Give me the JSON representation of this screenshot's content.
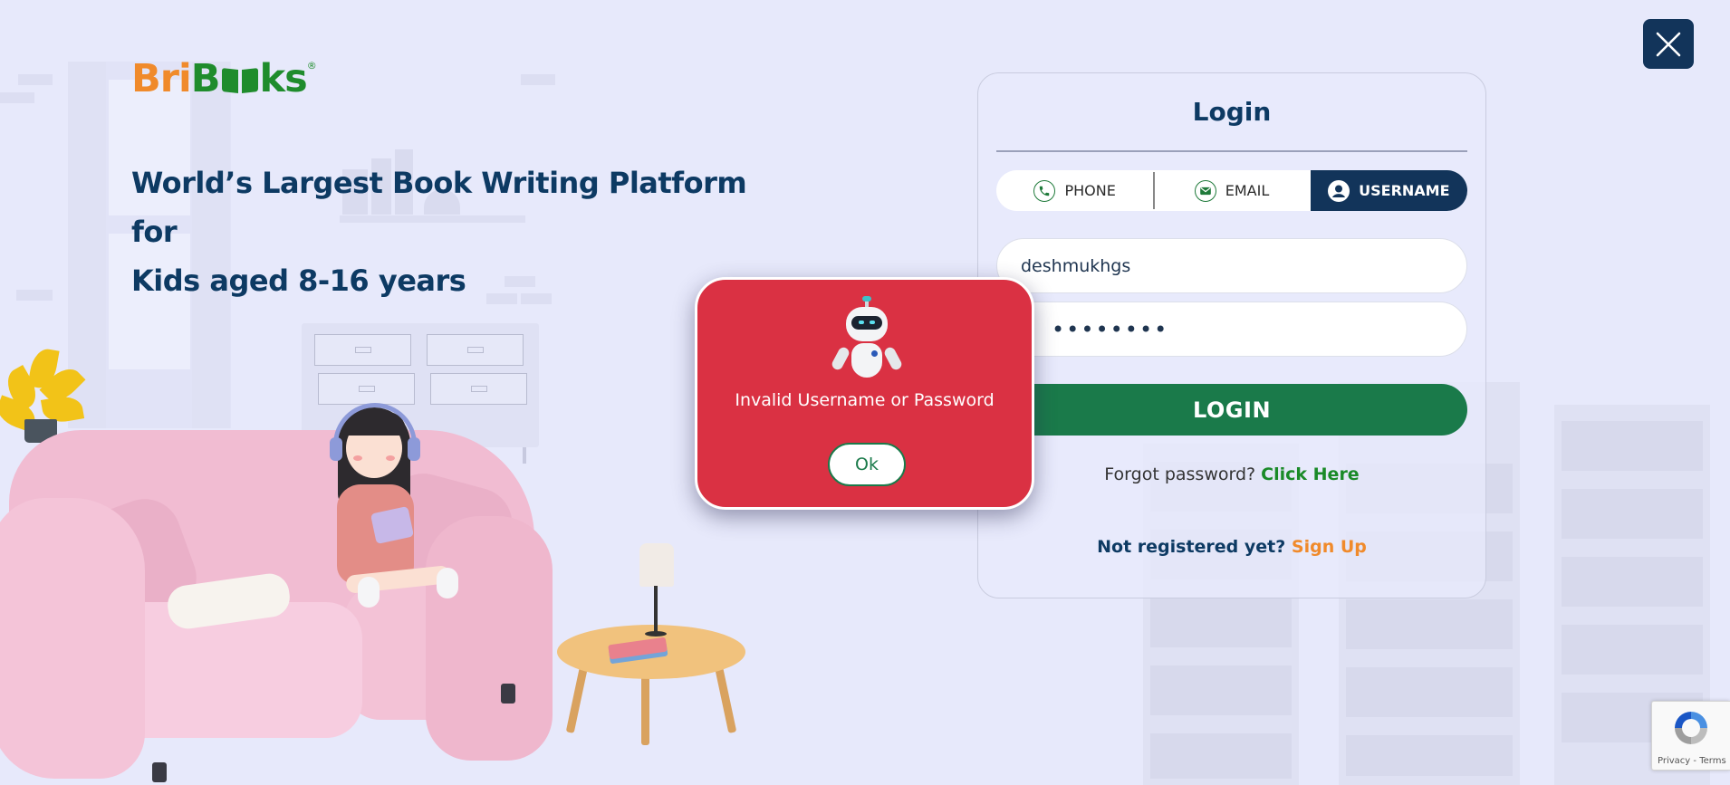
{
  "brand": {
    "logo_text_left": "Bri",
    "logo_text_right": "ks",
    "registered_mark": "®",
    "colors": {
      "orange": "#f08a2b",
      "green": "#1f8c2c",
      "navy": "#12345a"
    }
  },
  "hero": {
    "headline_line1": "World’s Largest Book Writing Platform for",
    "headline_line2": "Kids aged 8-16 years"
  },
  "close_button": {
    "icon": "close-icon"
  },
  "login": {
    "title": "Login",
    "tabs": [
      {
        "label": "PHONE",
        "icon": "phone-icon",
        "active": false
      },
      {
        "label": "EMAIL",
        "icon": "mail-icon",
        "active": false
      },
      {
        "label": "USERNAME",
        "icon": "user-icon",
        "active": true
      }
    ],
    "username_value": "deshmukhgs",
    "password_masked": "••••••••",
    "login_button": "LOGIN",
    "forgot_text": "Forgot password?",
    "forgot_link": "Click Here",
    "signup_text": "Not registered yet?",
    "signup_link": "Sign Up"
  },
  "error_modal": {
    "icon": "robot-icon",
    "message": "Invalid Username or Password",
    "ok_label": "Ok",
    "color": "#da3143"
  },
  "recaptcha": {
    "privacy": "Privacy",
    "separator": "-",
    "terms": "Terms"
  }
}
